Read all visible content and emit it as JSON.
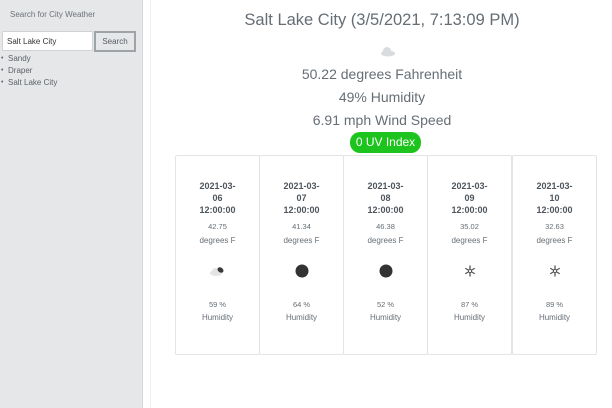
{
  "sidebar": {
    "heading": "Search for City Weather",
    "search": {
      "value": "Salt Lake City",
      "button_label": "Search"
    },
    "history": [
      {
        "label": "Sandy"
      },
      {
        "label": "Draper"
      },
      {
        "label": "Salt Lake City"
      }
    ]
  },
  "current": {
    "title": "Salt Lake City (3/5/2021, 7:13:09 PM)",
    "icon": "overcast-cloud-icon",
    "temperature": "50.22 degrees Fahrenheit",
    "humidity": "49% Humidity",
    "wind": "6.91 mph Wind Speed",
    "uv": "0 UV Index",
    "uv_color": "#1dc41d"
  },
  "forecast": [
    {
      "date_line1": "2021-03-",
      "date_line2": "06",
      "time": "12:00:00",
      "temp": "42.75",
      "temp_unit": "degrees F",
      "icon": "partly-cloudy-icon",
      "humidity": "59 %",
      "humidity_label": "Humidity"
    },
    {
      "date_line1": "2021-03-",
      "date_line2": "07",
      "time": "12:00:00",
      "temp": "41.34",
      "temp_unit": "degrees F",
      "icon": "cloud-dot-icon",
      "humidity": "64 %",
      "humidity_label": "Humidity"
    },
    {
      "date_line1": "2021-03-",
      "date_line2": "08",
      "time": "12:00:00",
      "temp": "46.38",
      "temp_unit": "degrees F",
      "icon": "cloud-dot-icon",
      "humidity": "52 %",
      "humidity_label": "Humidity"
    },
    {
      "date_line1": "2021-03-",
      "date_line2": "09",
      "time": "12:00:00",
      "temp": "35.02",
      "temp_unit": "degrees F",
      "icon": "snowflake-icon",
      "humidity": "87 %",
      "humidity_label": "Humidity"
    },
    {
      "date_line1": "2021-03-",
      "date_line2": "10",
      "time": "12:00:00",
      "temp": "32.63",
      "temp_unit": "degrees F",
      "icon": "snowflake-icon",
      "humidity": "89 %",
      "humidity_label": "Humidity"
    }
  ]
}
